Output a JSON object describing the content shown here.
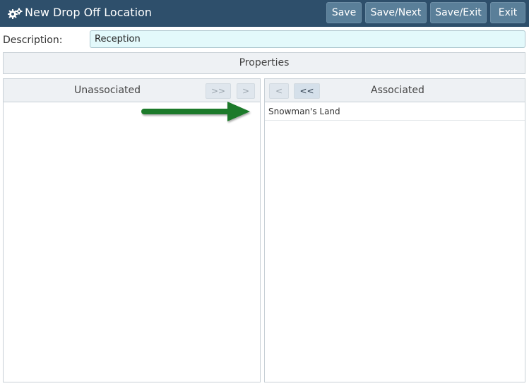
{
  "window": {
    "title": "New Drop Off Location",
    "icon": "gears-icon"
  },
  "toolbar": {
    "save_label": "Save",
    "save_next_label": "Save/Next",
    "save_exit_label": "Save/Exit",
    "exit_label": "Exit"
  },
  "form": {
    "description_label": "Description:",
    "description_value": "Reception"
  },
  "properties_label": "Properties",
  "unassociated": {
    "title": "Unassociated",
    "move_all_label": ">>",
    "move_one_label": ">",
    "items": []
  },
  "associated": {
    "title": "Associated",
    "move_one_label": "<",
    "move_all_label": "<<",
    "items": [
      {
        "label": "Snowman's Land"
      }
    ]
  },
  "colors": {
    "titlebar": "#2e4f6b",
    "toolbar_button": "#5a7f99",
    "input_background": "#e3f9fb",
    "annotation_arrow": "#1e7a2a"
  }
}
